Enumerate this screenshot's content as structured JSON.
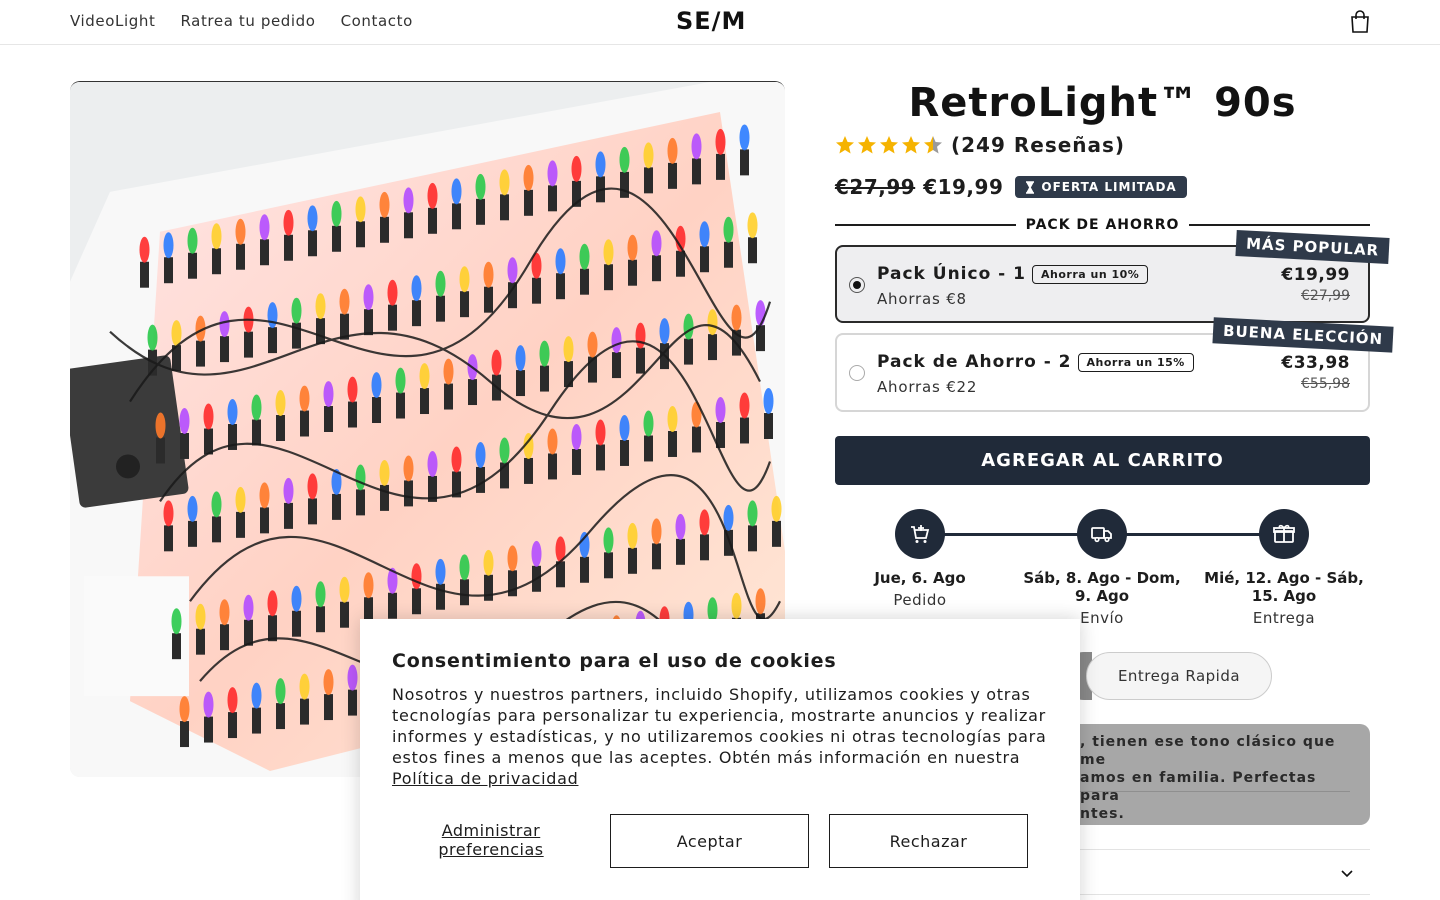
{
  "header": {
    "nav": [
      "VideoLight",
      "Ratrea tu pedido",
      "Contacto"
    ],
    "logo": "SE/M"
  },
  "product": {
    "title": "RetroLight™ 90s",
    "rating": 4.5,
    "reviews": "(249 Reseñas)",
    "price_old": "€27,99",
    "price_new": "€19,99",
    "offer_badge": "OFERTA LIMITADA",
    "pack_heading": "PACK DE AHORRO",
    "packs": [
      {
        "title": "Pack Único - 1",
        "tag": "Ahorra un 10%",
        "sub": "Ahorras €8",
        "price": "€19,99",
        "price_old": "€27,99",
        "ribbon": "MÁS POPULAR",
        "selected": true
      },
      {
        "title": "Pack de Ahorro - 2",
        "tag": "Ahorra un 15%",
        "sub": "Ahorras €22",
        "price": "€33,98",
        "price_old": "€55,98",
        "ribbon": "BUENA ELECCIÓN",
        "selected": false
      }
    ],
    "add_to_cart": "AGREGAR AL CARRITO"
  },
  "timeline": [
    {
      "icon": "cart-plus-icon",
      "date": "Jue, 6. Ago",
      "label": "Pedido"
    },
    {
      "icon": "truck-icon",
      "date": "Sáb, 8. Ago - Dom, 9. Ago",
      "label": "Envío"
    },
    {
      "icon": "gift-icon",
      "date": "Mié, 12. Ago - Sáb, 15. Ago",
      "label": "Entrega"
    }
  ],
  "delivery_pill": "Entrega Rapida",
  "review_snippet": ", tienen ese tono clásico que me\namos en familia. Perfectas para\nntes.",
  "cookie": {
    "title": "Consentimiento para el uso de cookies",
    "text": "Nosotros y nuestros partners, incluido Shopify, utilizamos cookies y otras tecnologías para personalizar tu experiencia, mostrarte anuncios y realizar informes y estadísticas, y no utilizaremos cookies ni otras tecnologías para estos fines a menos que las aceptes. Obtén más información en nuestra",
    "link": "Política de privacidad",
    "manage": "Administrar preferencias",
    "accept": "Aceptar",
    "reject": "Rechazar"
  },
  "colors": {
    "accent": "#202a39",
    "badge": "#2f3a4a",
    "star": "#f5b301"
  }
}
